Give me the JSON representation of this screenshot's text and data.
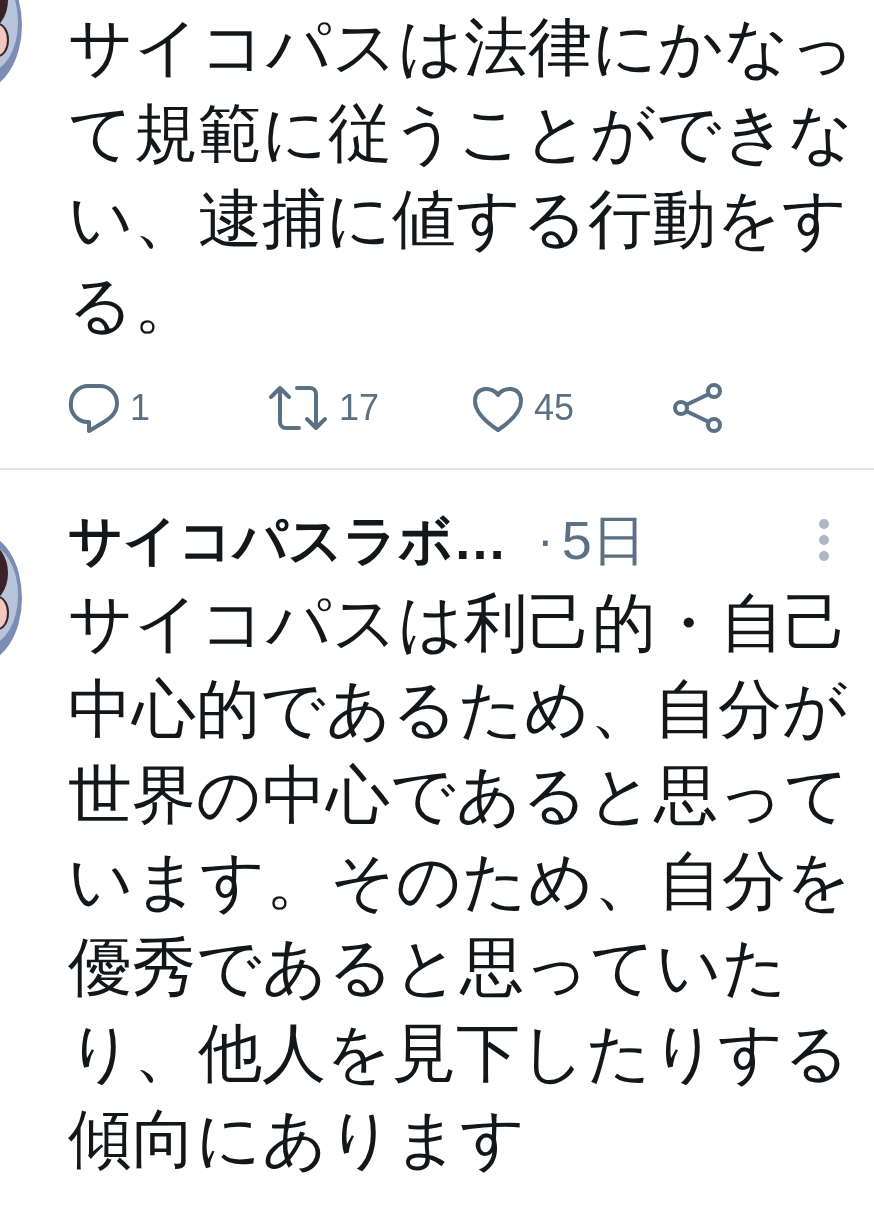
{
  "tweets": [
    {
      "text": "サイコパスは法律にかなって規範に従うことができない、逮捕に値する行動をする。",
      "actions": {
        "replies": "1",
        "retweets": "17",
        "likes": "45"
      }
    },
    {
      "author": "サイコパスラボ…",
      "separator": "·",
      "time": "5日",
      "text": "サイコパスは利己的・自己中心的であるため、自分が世界の中心であると思っています。そのため、自分を優秀であると思っていたり、他人を見下したりする傾向にあります"
    }
  ]
}
